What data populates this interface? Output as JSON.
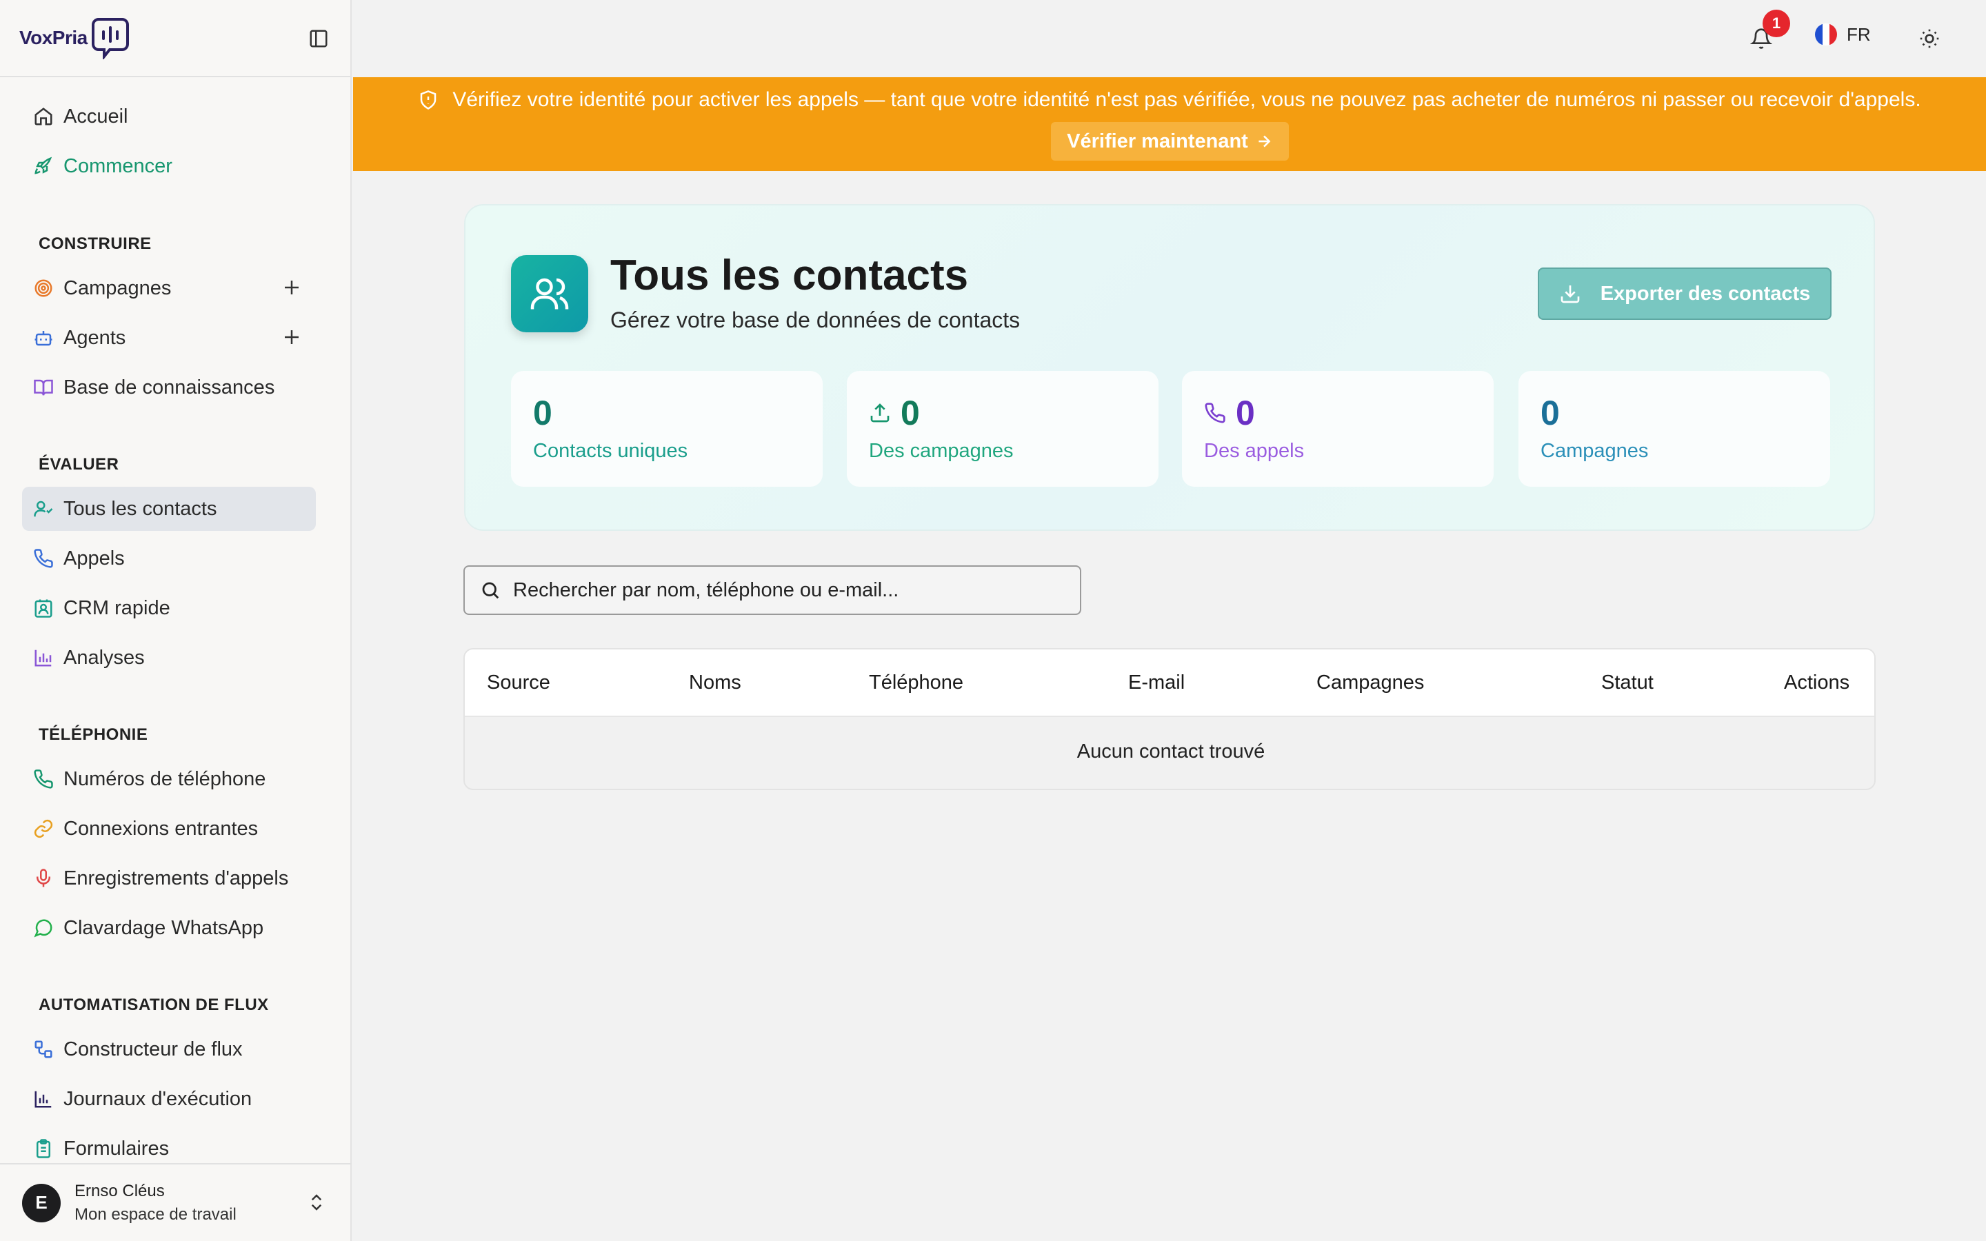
{
  "brand": {
    "name": "VoxPria"
  },
  "sidebar": {
    "items": [
      {
        "label": "Accueil",
        "icon": "home-icon"
      },
      {
        "label": "Commencer",
        "icon": "rocket-icon"
      }
    ],
    "sections": {
      "construire": {
        "title": "CONSTRUIRE",
        "items": [
          {
            "label": "Campagnes",
            "icon": "target-icon"
          },
          {
            "label": "Agents",
            "icon": "bot-icon"
          },
          {
            "label": "Base de connaissances",
            "icon": "book-icon"
          }
        ]
      },
      "evaluer": {
        "title": "ÉVALUER",
        "items": [
          {
            "label": "Tous les contacts",
            "icon": "user-check-icon"
          },
          {
            "label": "Appels",
            "icon": "phone-icon"
          },
          {
            "label": "CRM rapide",
            "icon": "contact-card-icon"
          },
          {
            "label": "Analyses",
            "icon": "bar-chart-icon"
          }
        ]
      },
      "telephonie": {
        "title": "TÉLÉPHONIE",
        "items": [
          {
            "label": "Numéros de téléphone",
            "icon": "phone-icon"
          },
          {
            "label": "Connexions entrantes",
            "icon": "link-icon"
          },
          {
            "label": "Enregistrements d'appels",
            "icon": "mic-icon"
          },
          {
            "label": "Clavardage WhatsApp",
            "icon": "chat-bubble-icon"
          }
        ]
      },
      "automatisation": {
        "title": "AUTOMATISATION DE FLUX",
        "items": [
          {
            "label": "Constructeur de flux",
            "icon": "workflow-icon"
          },
          {
            "label": "Journaux d'exécution",
            "icon": "bar-chart-icon"
          },
          {
            "label": "Formulaires",
            "icon": "clipboard-icon"
          }
        ]
      }
    },
    "user": {
      "initial": "E",
      "name": "Ernso Cléus",
      "workspace": "Mon espace de travail"
    }
  },
  "topbar": {
    "notifications_count": "1",
    "language": "FR"
  },
  "banner": {
    "message": "Vérifiez votre identité pour activer les appels — tant que votre identité n'est pas vérifiée, vous ne pouvez pas acheter de numéros ni passer ou recevoir d'appels.",
    "button_label": "Vérifier maintenant"
  },
  "page": {
    "title": "Tous les contacts",
    "subtitle": "Gérez votre base de données de contacts",
    "export_label": "Exporter des contacts"
  },
  "stats": [
    {
      "value": "0",
      "label": "Contacts uniques"
    },
    {
      "value": "0",
      "label": "Des campagnes"
    },
    {
      "value": "0",
      "label": "Des appels"
    },
    {
      "value": "0",
      "label": "Campagnes"
    }
  ],
  "search": {
    "placeholder": "Rechercher par nom, téléphone ou e-mail..."
  },
  "table": {
    "columns": [
      "Source",
      "Noms",
      "Téléphone",
      "E-mail",
      "Campagnes",
      "Statut",
      "Actions"
    ],
    "empty_message": "Aucun contact trouvé"
  },
  "colors": {
    "banner": "#f49d10",
    "accent_teal": "#1a9e8c",
    "green": "#16966e",
    "purple": "#7b3fd0",
    "blue_teal": "#1a7fa0"
  }
}
